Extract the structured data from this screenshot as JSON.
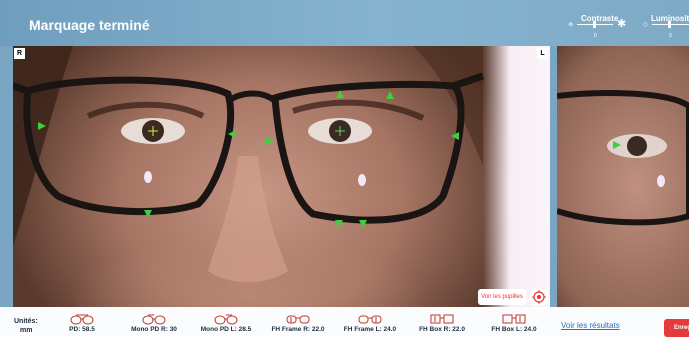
{
  "header": {
    "title": "Marquage terminé",
    "contrast_label": "Contraste",
    "contrast_value": "0",
    "brightness_label": "Luminosité",
    "brightness_value": "0"
  },
  "photo": {
    "left_corner": "R",
    "right_corner": "L",
    "pupils_button": "Voir les pupilles"
  },
  "footer": {
    "units_label": "Unités:",
    "units_value": "mm",
    "measurements": [
      {
        "label": "PD: 58.5",
        "icon": "pd-glasses-icon"
      },
      {
        "label": "Mono PD R: 30",
        "icon": "mono-pd-right-icon"
      },
      {
        "label": "Mono PD L: 28.5",
        "icon": "mono-pd-left-icon"
      },
      {
        "label": "FH Frame R: 22.0",
        "icon": "fh-frame-right-icon"
      },
      {
        "label": "FH Frame L: 24.0",
        "icon": "fh-frame-left-icon"
      },
      {
        "label": "FH Box R: 22.0",
        "icon": "fh-box-right-icon"
      },
      {
        "label": "FH Box L: 24.0",
        "icon": "fh-box-left-icon"
      }
    ],
    "results_link": "Voir les résultats",
    "save_button": "Enregi"
  },
  "colors": {
    "header": "#7aa6c4",
    "marker": "#3ecf3e",
    "accent_red": "#e53a3a",
    "link_blue": "#2a6ec6"
  }
}
